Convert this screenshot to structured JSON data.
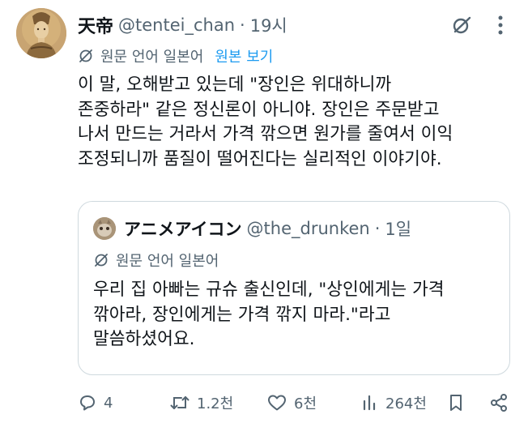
{
  "tweet": {
    "author": {
      "display_name": "天帝",
      "handle": "@tentei_chan",
      "separator": "·",
      "time": "19시"
    },
    "translation": {
      "label": "원문 언어 일본어",
      "show_original": "원본 보기"
    },
    "text_lines": [
      "이 말, 오해받고 있는데 \"장인은 위대하니까",
      "존중하라\" 같은 정신론이 아니야. 장인은 주문받고",
      "나서 만드는 거라서 가격 깎으면 원가를 줄여서 이익",
      "조정되니까 품질이 떨어진다는 실리적인 이야기야."
    ]
  },
  "quote": {
    "author": {
      "display_name": "アニメアイコン",
      "handle": "@the_drunken",
      "separator": "·",
      "time": "1일"
    },
    "translation": {
      "label": "원문 언어 일본어"
    },
    "text_lines": [
      "우리 집 아빠는 규슈 출신인데, \"상인에게는 가격",
      "깎아라, 장인에게는 가격 깎지 마라.\"라고",
      "말씀하셨어요."
    ]
  },
  "actions": {
    "reply_count": "4",
    "retweet_count": "1.2천",
    "like_count": "6천",
    "view_count": "264천"
  },
  "icons": {
    "avatar": "buddhist-deity-painting",
    "grok": "grok-icon",
    "translate": "translate-icon",
    "reply": "reply-icon",
    "retweet": "retweet-icon",
    "like": "heart-icon",
    "views": "views-icon",
    "bookmark": "bookmark-icon",
    "share": "share-icon"
  },
  "colors": {
    "text": "#0f1419",
    "secondary": "#536471",
    "link": "#1d9bf0",
    "border": "#cfd9de"
  }
}
